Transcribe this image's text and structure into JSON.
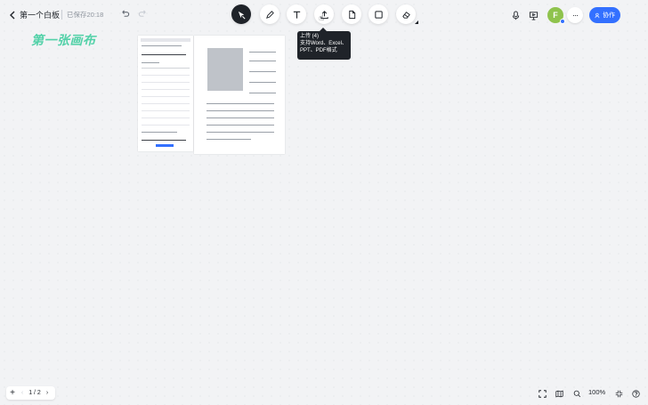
{
  "header": {
    "title": "第一个白板",
    "saved_status": "已保存20:18",
    "back_icon": "chevron-left-icon",
    "undo_icon": "undo-icon",
    "redo_icon": "redo-icon"
  },
  "toolbar": {
    "tools": [
      {
        "name": "select",
        "icon": "select-cursor-icon",
        "active": true
      },
      {
        "name": "pen",
        "icon": "pen-icon"
      },
      {
        "name": "text",
        "icon": "text-icon",
        "glyph": "T"
      },
      {
        "name": "upload",
        "icon": "upload-icon"
      },
      {
        "name": "document",
        "icon": "document-icon"
      },
      {
        "name": "shape",
        "icon": "square-icon"
      },
      {
        "name": "eraser",
        "icon": "eraser-icon"
      }
    ]
  },
  "tooltip": {
    "line1": "上传 (4)",
    "line2": "支持Word、Excel、",
    "line3": "PPT、PDF格式"
  },
  "right_header": {
    "mic_icon": "microphone-icon",
    "present_icon": "presentation-icon",
    "avatar_initial": "F",
    "more_label": "···",
    "collab_label": "协作",
    "accent": "#3370ff",
    "avatar_color": "#8fc34d"
  },
  "canvas": {
    "title": "第一张画布",
    "title_color": "#52d1a8"
  },
  "footer": {
    "add_label": "+",
    "page_indicator": "1 / 2",
    "zoom_level": "100%",
    "icons": [
      "fit-screen-icon",
      "map-icon",
      "search-icon",
      "help-icon"
    ]
  }
}
